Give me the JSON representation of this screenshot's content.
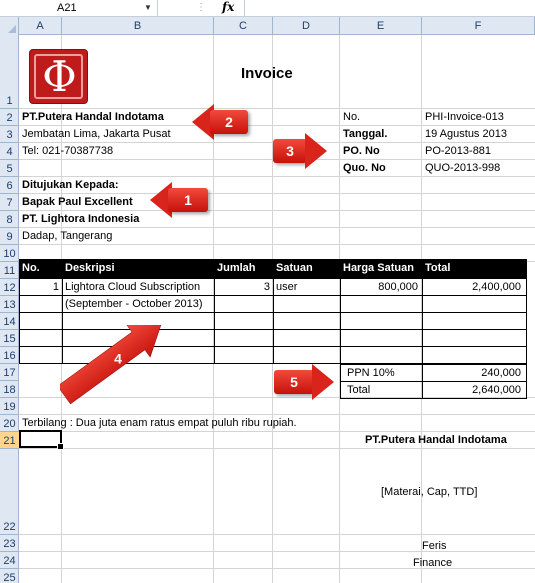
{
  "formula_bar": {
    "cell_ref": "A21",
    "fx": "fx"
  },
  "columns": [
    "A",
    "B",
    "C",
    "D",
    "E",
    "F"
  ],
  "rows": [
    "1",
    "2",
    "3",
    "4",
    "5",
    "6",
    "7",
    "8",
    "9",
    "10",
    "11",
    "12",
    "13",
    "14",
    "15",
    "16",
    "17",
    "18",
    "19",
    "20",
    "21",
    "22",
    "23",
    "24",
    "25"
  ],
  "invoice": {
    "title": "Invoice",
    "company": "PT.Putera Handal Indotama",
    "address": "Jembatan Lima, Jakarta Pusat",
    "tel": "Tel: 021-70387738",
    "to_label": "Ditujukan Kepada:",
    "to_person": "Bapak Paul Excellent",
    "to_company": "PT. Lightora Indonesia",
    "to_city": "Dadap, Tangerang",
    "meta": [
      {
        "label": "No.",
        "value": "PHI-Invoice-013"
      },
      {
        "label": "Tanggal.",
        "value": "19 Agustus 2013"
      },
      {
        "label": "PO. No",
        "value": "PO-2013-881"
      },
      {
        "label": "Quo. No",
        "value": "QUO-2013-998"
      }
    ],
    "table_headers": [
      "No.",
      "Deskripsi",
      "Jumlah",
      "Satuan",
      "Harga Satuan",
      "Total"
    ],
    "items": [
      {
        "no": "1",
        "desc": "Lightora Cloud Subscription",
        "qty": "3",
        "unit": "user",
        "price": "800,000",
        "total": "2,400,000"
      }
    ],
    "desc_note": "(September - October 2013)",
    "ppn_label": "PPN 10%",
    "ppn_value": "240,000",
    "total_label": "Total",
    "total_value": "2,640,000",
    "terbilang": "Terbilang : Dua juta enam ratus empat puluh ribu rupiah.",
    "sign_company": "PT.Putera Handal Indotama",
    "sign_stamp": "[Materai, Cap, TTD]",
    "sign_name": "Feris",
    "sign_title": "Finance"
  },
  "callouts": [
    "1",
    "2",
    "3",
    "4",
    "5"
  ],
  "colors": {
    "callout": "#d8241a",
    "logo": "#c01b1b",
    "header_bg": "#dfe7f2"
  }
}
